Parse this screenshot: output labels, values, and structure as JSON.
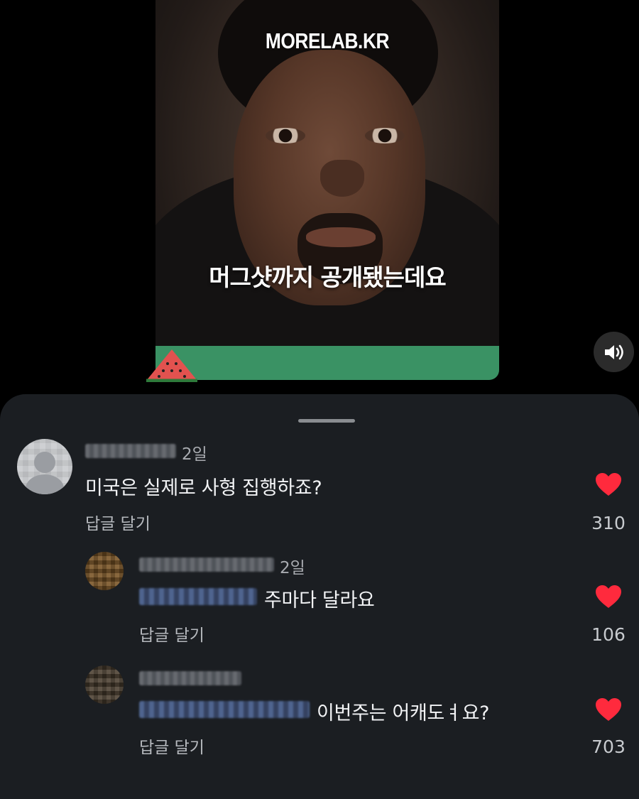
{
  "video": {
    "watermark": "MORELAB.KR",
    "caption": "머그샷까지 공개됐는데요",
    "mute_icon": "speaker-icon"
  },
  "colors": {
    "sheet_bg": "#1b1e22",
    "heart": "#ff2a3d",
    "video_footer": "#3a9264"
  },
  "comments": [
    {
      "time": "2일",
      "text": "미국은 실제로 사형 집행하죠?",
      "reply_label": "답글 달기",
      "likes": "310"
    },
    {
      "time": "2일",
      "text": "주마다 달라요",
      "reply_label": "답글 달기",
      "likes": "106"
    },
    {
      "time": "",
      "text": "이번주는 어캐도ㅕ요?",
      "reply_label": "답글 달기",
      "likes": "703"
    }
  ]
}
